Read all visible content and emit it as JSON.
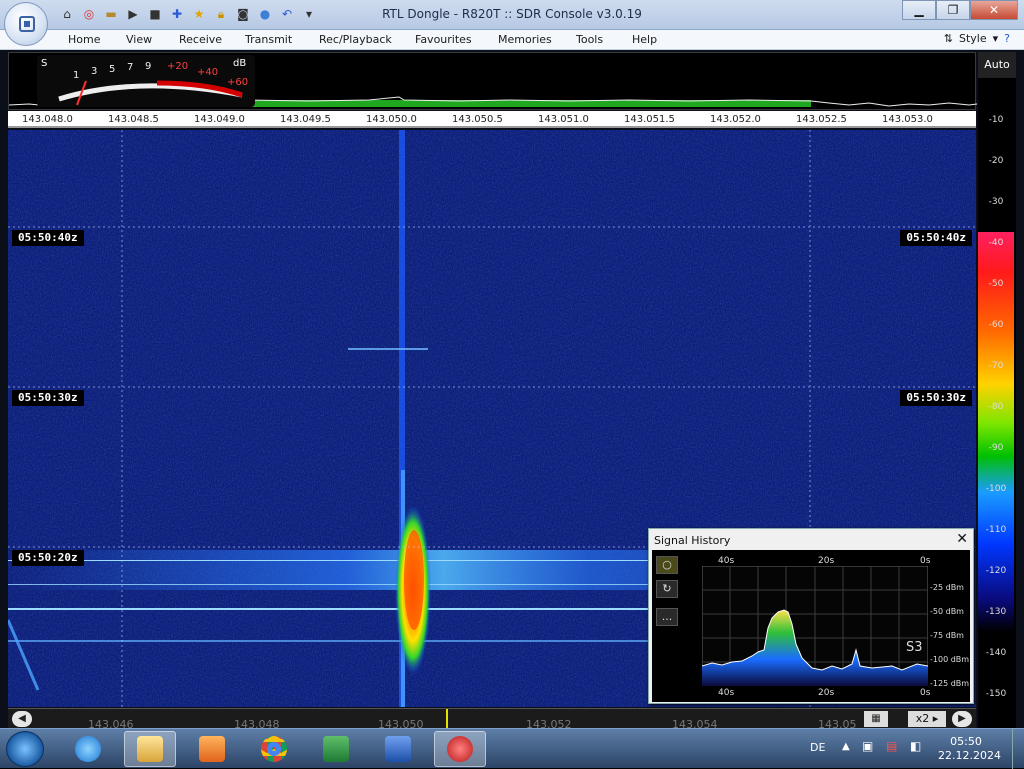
{
  "window": {
    "title": "RTL Dongle - R820T :: SDR Console v3.0.19"
  },
  "menu": {
    "items": [
      "Home",
      "View",
      "Receive",
      "Transmit",
      "Rec/Playback",
      "Favourites",
      "Memories",
      "Tools",
      "Help"
    ],
    "style": "Style"
  },
  "smeter": {
    "s_label": "S",
    "db_label": "dB",
    "scale": [
      "1",
      "3",
      "5",
      "7",
      "9",
      "+20",
      "+40",
      "+60"
    ]
  },
  "frequency_scale": [
    "143.048.0",
    "143.048.5",
    "143.049.0",
    "143.049.5",
    "143.050.0",
    "143.050.5",
    "143.051.0",
    "143.051.5",
    "143.052.0",
    "143.052.5",
    "143.053.0"
  ],
  "waterfall": {
    "timestamps": [
      "05:50:40z",
      "05:50:30z",
      "05:50:20z"
    ]
  },
  "db_scale": {
    "auto_label": "Auto",
    "labels": [
      "-10",
      "-20",
      "-30",
      "-40",
      "-50",
      "-60",
      "-70",
      "-80",
      "-90",
      "-100",
      "-110",
      "-120",
      "-130",
      "-140",
      "-150"
    ]
  },
  "bottom_bar": {
    "freqs": [
      "143.046",
      "143.048",
      "143.050",
      "143.052",
      "143.054",
      "143.05"
    ],
    "zoom": "x2"
  },
  "signal_history": {
    "title": "Signal History",
    "time_labels": [
      "40s",
      "20s",
      "0s"
    ],
    "dbm_labels": [
      "-25 dBm",
      "-50 dBm",
      "-75 dBm",
      "-100 dBm",
      "-125 dBm"
    ],
    "s_reading": "S3",
    "button_more": "..."
  },
  "taskbar": {
    "language": "DE",
    "time": "05:50",
    "date": "22.12.2024"
  },
  "colors": {
    "waterfall_bg": "#0a1a6a",
    "accent": "#3a63a6"
  }
}
